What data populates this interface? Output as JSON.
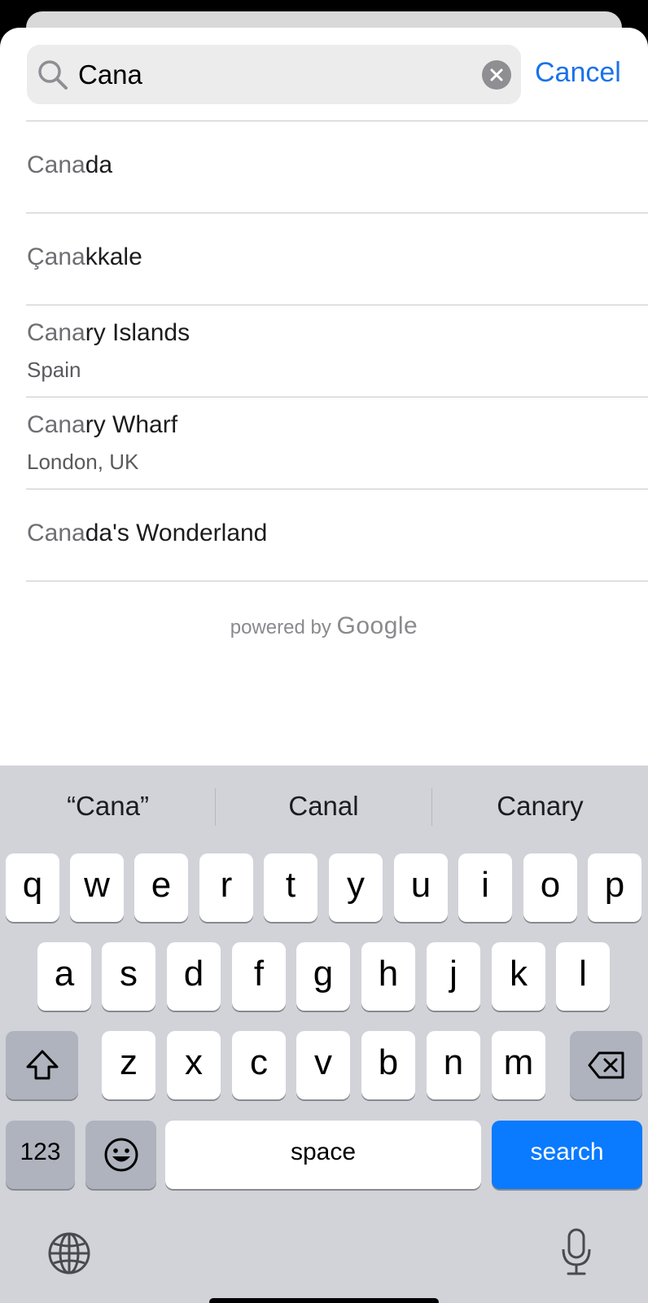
{
  "search": {
    "query": "Cana",
    "cancel_label": "Cancel"
  },
  "results": [
    {
      "match": "Cana",
      "rest": "da",
      "subtitle": ""
    },
    {
      "match": "Çana",
      "rest": "kkale",
      "subtitle": ""
    },
    {
      "match": "Cana",
      "rest": "ry Islands",
      "subtitle": "Spain"
    },
    {
      "match": "Cana",
      "rest": "ry Wharf",
      "subtitle": "London, UK"
    },
    {
      "match": "Cana",
      "rest": "da's Wonderland",
      "subtitle": ""
    }
  ],
  "attribution": {
    "prefix": "powered by",
    "brand": "Google"
  },
  "keyboard": {
    "suggestions": [
      "“Cana”",
      "Canal",
      "Canary"
    ],
    "row1": [
      "q",
      "w",
      "e",
      "r",
      "t",
      "y",
      "u",
      "i",
      "o",
      "p"
    ],
    "row2": [
      "a",
      "s",
      "d",
      "f",
      "g",
      "h",
      "j",
      "k",
      "l"
    ],
    "row3": [
      "z",
      "x",
      "c",
      "v",
      "b",
      "n",
      "m"
    ],
    "numbers_label": "123",
    "space_label": "space",
    "search_label": "search"
  },
  "colors": {
    "accent": "#1a73e8",
    "search_key": "#0a7aff",
    "keyboard_bg": "#d1d3d9"
  },
  "icons": {
    "search": "magnifier-icon",
    "clear": "clear-circle-icon",
    "shift": "shift-arrow-icon",
    "delete": "backspace-icon",
    "emoji": "emoji-icon",
    "globe": "globe-icon",
    "microphone": "microphone-icon"
  }
}
